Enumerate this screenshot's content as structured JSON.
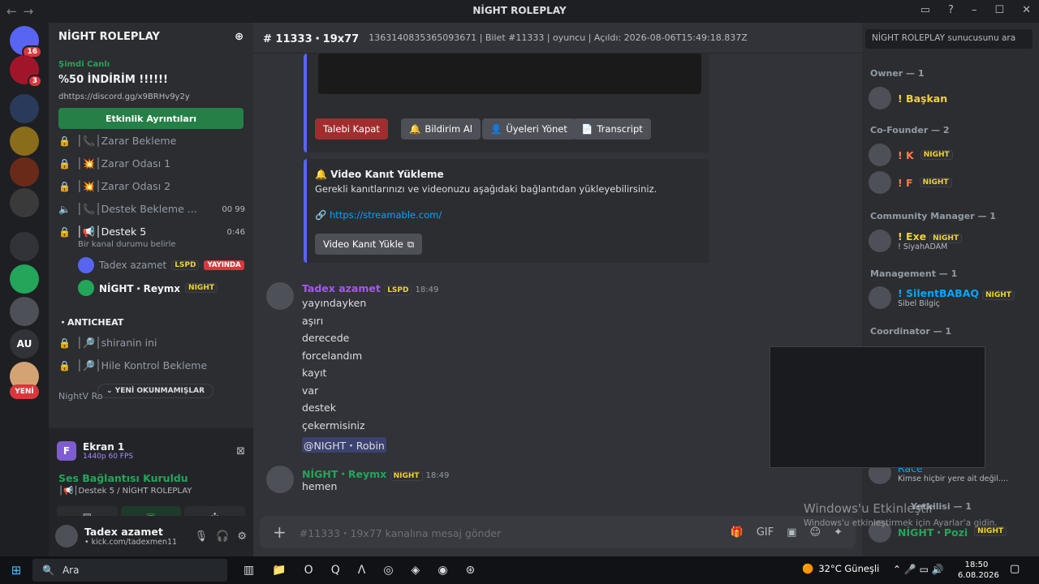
{
  "window": {
    "title": "NİGHT ROLEPLAY",
    "nav_back": "←",
    "nav_fwd": "→"
  },
  "guilds": [
    {
      "label": "",
      "badge": "16",
      "color": "#5865f2"
    },
    {
      "label": "",
      "badge": "3",
      "color": "#a1152a"
    },
    {
      "label": "",
      "badge": "",
      "color": "#2a3a5a"
    },
    {
      "label": "",
      "badge": "",
      "color": "#8a6d1a"
    },
    {
      "label": "",
      "badge": "",
      "color": "#6a2a1a"
    },
    {
      "label": "",
      "badge": "",
      "color": "#3a3a3a"
    },
    {
      "label": "",
      "badge": "",
      "color": "#313338"
    },
    {
      "label": "",
      "badge": "",
      "color": "#23a55a"
    },
    {
      "label": "",
      "badge": "",
      "color": "#4e5058"
    },
    {
      "label": "AU",
      "badge": "",
      "color": "#313338"
    },
    {
      "label": "",
      "badge": "",
      "color": "#d4a373"
    },
    {
      "label": "YENİ",
      "badge": "",
      "color": "#da373c"
    }
  ],
  "sidebar": {
    "server_name": "NİGHT ROLEPLAY",
    "event": {
      "status": "Şimdi Canlı",
      "title": "%50 İNDİRİM !!!!!!",
      "link": "dhttps://discord.gg/x9BRHv9y2y",
      "button": "Etkinlik Ayrıntıları"
    },
    "channels": [
      {
        "name": "│📞│Zarar Bekleme",
        "num": ""
      },
      {
        "name": "│💥│Zarar Odası 1",
        "num": ""
      },
      {
        "name": "│💥│Zarar Odası 2",
        "num": ""
      },
      {
        "name": "│📞│Destek Bekleme ...",
        "num": "00  99"
      },
      {
        "name": "│📢│Destek 5",
        "num": "0:46"
      }
    ],
    "voice_status": "Bir kanal durumu belirle",
    "voice_users": [
      {
        "name": "Tadex azamet",
        "tag": "LSPD",
        "live": "YAYINDA"
      },
      {
        "name": "NİGHT・Reymx",
        "tag": "NIGHT",
        "live": ""
      }
    ],
    "category": "・ANTICHEAT",
    "channels2": [
      {
        "name": "│🔎│shiranin ini"
      },
      {
        "name": "│🔎│Hile Kontrol Bekleme"
      }
    ],
    "unread_label": "YENİ OKUNMAMIŞLAR",
    "partial": "NightV Ro"
  },
  "panel": {
    "screen_title": "Ekran 1",
    "screen_sub": "1440p 60 FPS",
    "voice_title": "Ses Bağlantısı Kuruldu",
    "voice_sub": "│📢│Destek 5 / NİGHT ROLEPLAY"
  },
  "user": {
    "name": "Tadex azamet",
    "status": "• kick.com/tadexmen11"
  },
  "channel": {
    "name": "11333・19x77",
    "topic": "1363140835365093671 | Bilet #11333 | oyuncu | Açıldı: 2026-08-06T15:49:18.837Z"
  },
  "embed1": {
    "buttons": [
      "Talebi Kapat",
      "Bildirim Al",
      "Üyeleri Yönet",
      "Transcript"
    ]
  },
  "embed2": {
    "title": "🔔 Video Kanıt Yükleme",
    "desc": "Gerekli kanıtlarınızı ve videonuzu aşağıdaki bağlantıdan yükleyebilirsiniz.",
    "link": "https://streamable.com/",
    "button": "Video Kanıt Yükle"
  },
  "messages": [
    {
      "user": "Tadex azamet",
      "tag": "LSPD",
      "time": "18:49",
      "lines": [
        "yayındayken",
        "aşırı",
        "derecede",
        "forcelandım",
        "kayıt",
        "var",
        "destek",
        "çekermisiniz"
      ],
      "mention": "@NIGHT・Robin"
    },
    {
      "user": "NİGHT・Reymx",
      "tag": "NIGHT",
      "time": "18:49",
      "lines": [
        "hemen"
      ]
    }
  ],
  "composer": {
    "placeholder": "#11333・19x77 kanalına mesaj gönder"
  },
  "members": {
    "search": "NİGHT ROLEPLAY sunucusunu ara",
    "roles": [
      {
        "label": "Owner — 1",
        "members": [
          {
            "name": "! Başkan",
            "sub": ""
          }
        ]
      },
      {
        "label": "Co-Founder — 2",
        "members": [
          {
            "name": "! K",
            "sub": ""
          },
          {
            "name": "! F",
            "sub": ""
          }
        ]
      },
      {
        "label": "Community Manager — 1",
        "members": [
          {
            "name": "! Exe",
            "sub": "! SiyahADAM"
          }
        ]
      },
      {
        "label": "Management — 1",
        "members": [
          {
            "name": "! SilentBABAQ",
            "sub": "Sibel Bilgiç"
          }
        ]
      },
      {
        "label": "Coordinator — 1",
        "members": []
      }
    ],
    "partial_member": {
      "name": "Race",
      "sub": "Kimse hiçbir yere ait değil...."
    },
    "partial_role": "Yetkilisi — 1",
    "partial_bottom": "NİGHT・Pozi"
  },
  "watermark": {
    "title": "Windows'u Etkinleştir",
    "sub": "Windows'u etkinleştirmek için Ayarlar'a gidin."
  },
  "taskbar": {
    "search": "Ara",
    "weather": "32°C  Güneşli",
    "time": "18:50",
    "date": "6.08.2026"
  },
  "colors": {
    "accent": "#5865f2",
    "green": "#23a55a",
    "red": "#da373c",
    "gold": "#f2d32e"
  }
}
